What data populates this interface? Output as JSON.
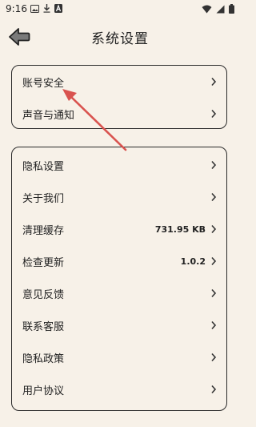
{
  "status_bar": {
    "time": "9:16",
    "icons_left": [
      "image-icon",
      "download-icon",
      "a-icon"
    ],
    "icons_right": [
      "wifi-icon",
      "signal-icon",
      "battery-icon"
    ]
  },
  "header": {
    "title": "系统设置",
    "back_icon": "back-arrow-icon"
  },
  "section1": {
    "items": [
      {
        "label": "账号安全"
      },
      {
        "label": "声音与通知"
      }
    ]
  },
  "section2": {
    "items": [
      {
        "label": "隐私设置"
      },
      {
        "label": "关于我们"
      },
      {
        "label": "清理缓存",
        "value": "731.95 KB"
      },
      {
        "label": "检查更新",
        "value": "1.0.2"
      },
      {
        "label": "意见反馈"
      },
      {
        "label": "联系客服"
      },
      {
        "label": "隐私政策"
      },
      {
        "label": "用户协议"
      }
    ]
  },
  "annotation": {
    "type": "arrow",
    "color": "#d9534f",
    "points_to": "账号安全"
  }
}
